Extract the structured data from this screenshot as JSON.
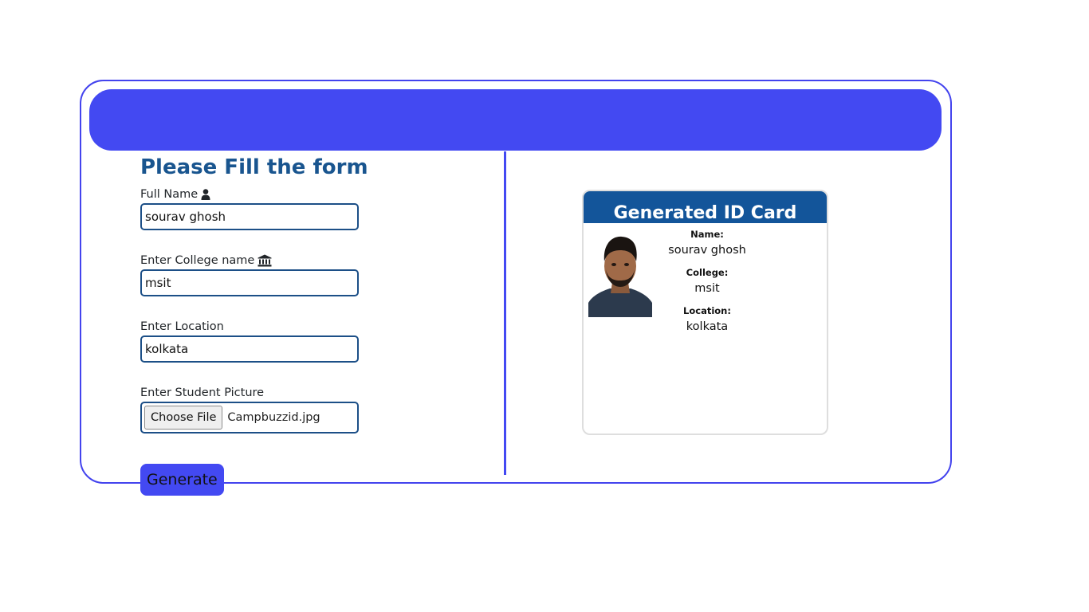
{
  "form": {
    "title": "Please Fill the form",
    "full_name": {
      "label": "Full Name",
      "value": "sourav ghosh",
      "icon": "user-icon"
    },
    "college": {
      "label": "Enter College name",
      "value": "msit",
      "icon": "bank-building-icon"
    },
    "location": {
      "label": "Enter Location",
      "value": "kolkata"
    },
    "picture": {
      "label": "Enter Student Picture",
      "button_label": "Choose File",
      "file_name": "Campbuzzid.jpg"
    },
    "generate_label": "Generate"
  },
  "id_card": {
    "title": "Generated ID Card",
    "name_key": "Name:",
    "name_value": "sourav ghosh",
    "college_key": "College:",
    "college_value": "msit",
    "location_key": "Location:",
    "location_value": "kolkata"
  },
  "colors": {
    "accent": "#4349f2",
    "heading": "#19558f",
    "card_header": "#13559a",
    "input_border": "#1c4f87"
  }
}
